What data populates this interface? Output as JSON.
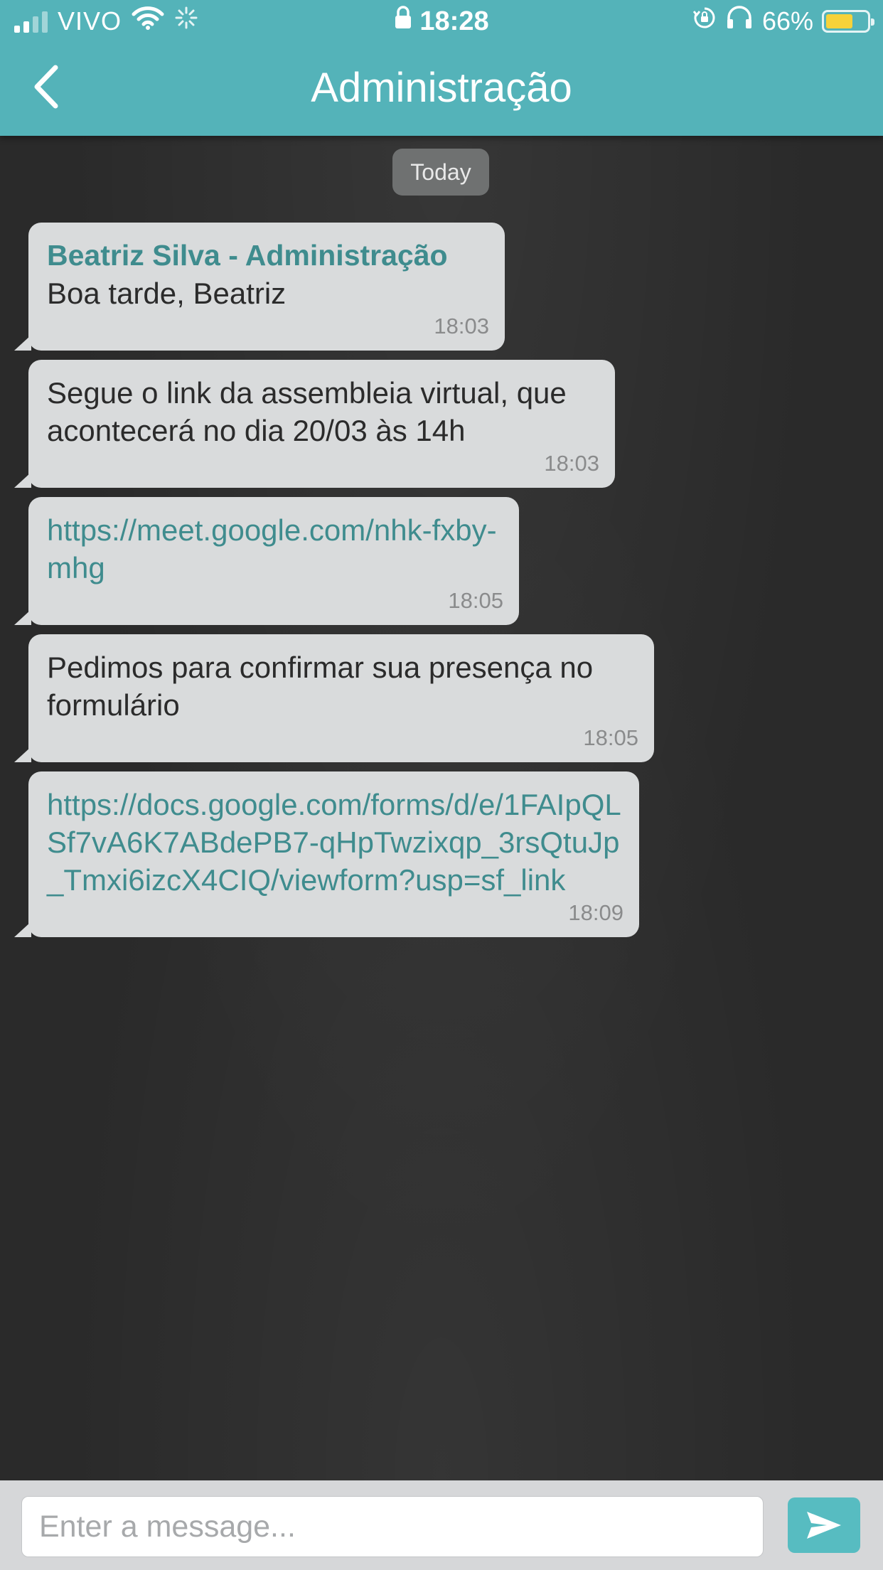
{
  "status_bar": {
    "carrier": "VIVO",
    "time": "18:28",
    "battery_text": "66%",
    "battery_level": 0.66,
    "icons": [
      "signal-icon",
      "wifi-icon",
      "activity-spinner-icon",
      "lock-icon",
      "rotation-lock-icon",
      "headphones-icon",
      "battery-icon"
    ]
  },
  "header": {
    "title": "Administração",
    "back_icon": "chevron-left-icon"
  },
  "chat": {
    "date_label": "Today",
    "messages": [
      {
        "sender": "Beatriz Silva - Administração",
        "text": "Boa tarde, Beatriz",
        "time": "18:03"
      },
      {
        "text": "Segue o link da assembleia virtual, que acontecerá no dia 20/03 às 14h",
        "time": "18:03"
      },
      {
        "text": "https://meet.google.com/nhk-fxby-mhg",
        "time": "18:05",
        "is_link": true
      },
      {
        "text": "Pedimos para confirmar sua presença no formulário",
        "time": "18:05"
      },
      {
        "text": "https://docs.google.com/forms/d/e/1FAIpQLSf7vA6K7ABdePB7-qHpTwzixqp_3rsQtuJp_Tmxi6izcX4CIQ/viewform?usp=sf_link",
        "time": "18:09",
        "is_link": true
      }
    ]
  },
  "composer": {
    "placeholder": "Enter a message...",
    "send_icon": "send-icon"
  },
  "colors": {
    "accent": "#54b3b9",
    "link": "#3f8c8e",
    "bubble": "#d9dbdc",
    "battery_fill": "#f6d23a"
  }
}
